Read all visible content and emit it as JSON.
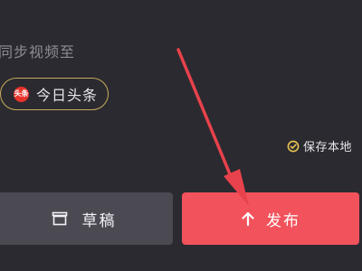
{
  "sync": {
    "title": "同步视频至",
    "platform_label": "今日头条",
    "platform_logo_text": "头条",
    "platform_logo_color": "#e8332b",
    "chip_border_color": "#c9ab5c"
  },
  "save_local": {
    "label": "保存本地",
    "checked": true,
    "icon": "check-circle-icon",
    "icon_color": "#e8c451"
  },
  "actions": {
    "draft_label": "草稿",
    "draft_icon": "draft-box-icon",
    "draft_color": "#4b4a53",
    "publish_label": "发布",
    "publish_icon": "upload-arrow-icon",
    "publish_color": "#f1525c"
  },
  "theme": {
    "background": "#2b2a30",
    "annotation_arrow_color": "#e8424c"
  }
}
